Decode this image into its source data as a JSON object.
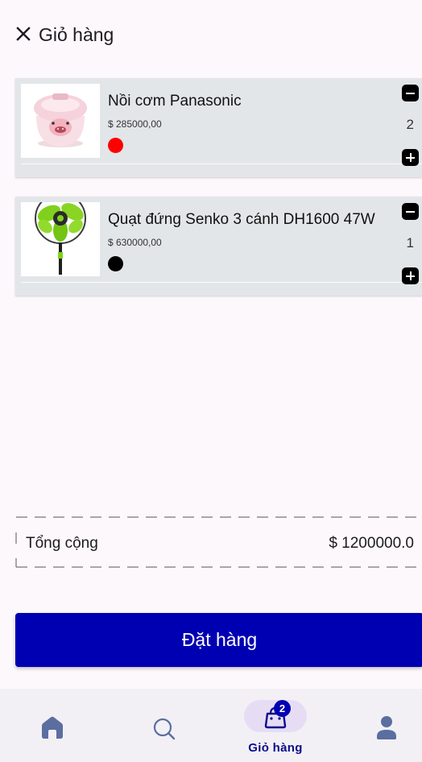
{
  "header": {
    "title": "Giỏ hàng"
  },
  "cart": {
    "items": [
      {
        "name": "Nồi cơm Panasonic",
        "price": "$ 285000,00",
        "color": "#ff0000",
        "quantity": "2",
        "image": "rice-cooker-image"
      },
      {
        "name": "Quạt đứng Senko 3 cánh DH1600 47W",
        "price": "$ 630000,00",
        "color": "#000000",
        "quantity": "1",
        "image": "standing-fan-image"
      }
    ]
  },
  "summary": {
    "total_label": "Tổng cộng",
    "total_value": "$ 1200000.0"
  },
  "actions": {
    "order_label": "Đặt hàng"
  },
  "bottom_nav": {
    "items": [
      {
        "icon": "home-icon",
        "label": ""
      },
      {
        "icon": "search-icon",
        "label": ""
      },
      {
        "icon": "shopping-bag-icon",
        "label": "Giỏ hàng",
        "badge": "2",
        "active": true
      },
      {
        "icon": "person-icon",
        "label": ""
      }
    ]
  },
  "colors": {
    "primary": "#0000b3",
    "card_background": "#e3e6e9",
    "page_background": "#fdf8fc",
    "nav_active_pill": "#e6ddf5"
  }
}
